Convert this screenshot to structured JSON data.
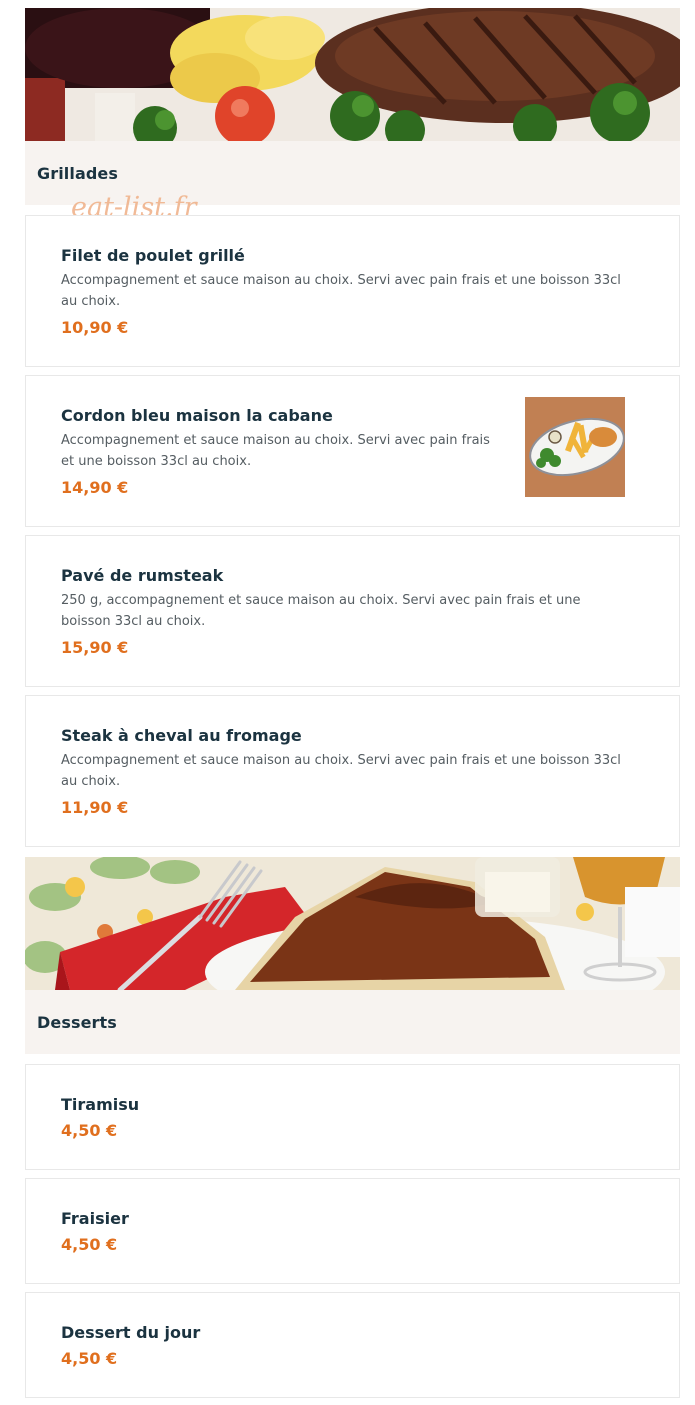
{
  "watermark": "eat-list.fr",
  "sections": [
    {
      "title": "Grillades",
      "items": [
        {
          "name": "Filet de poulet grillé",
          "description": "Accompagnement et sauce maison au choix. Servi avec pain frais et une boisson 33cl au choix.",
          "price": "10,90 €"
        },
        {
          "name": "Cordon bleu maison la cabane",
          "description": "Accompagnement et sauce maison au choix. Servi avec pain frais et une boisson 33cl au choix.",
          "price": "14,90 €",
          "image": "plate-with-fries-and-salad"
        },
        {
          "name": "Pavé de rumsteak",
          "description": "250 g, accompagnement et sauce maison au choix. Servi avec pain frais et une boisson 33cl au choix.",
          "price": "15,90 €"
        },
        {
          "name": "Steak à cheval au fromage",
          "description": "Accompagnement et sauce maison au choix. Servi avec pain frais et une boisson 33cl au choix.",
          "price": "11,90 €"
        }
      ]
    },
    {
      "title": "Desserts",
      "items": [
        {
          "name": "Tiramisu",
          "price": "4,50 €"
        },
        {
          "name": "Fraisier",
          "price": "4,50 €"
        },
        {
          "name": "Dessert du jour",
          "price": "4,50 €"
        }
      ]
    }
  ],
  "colors": {
    "price": "#e06f1e",
    "title": "#1b3340",
    "section_bg": "#f7f3f0",
    "border": "#e8e8e8"
  }
}
